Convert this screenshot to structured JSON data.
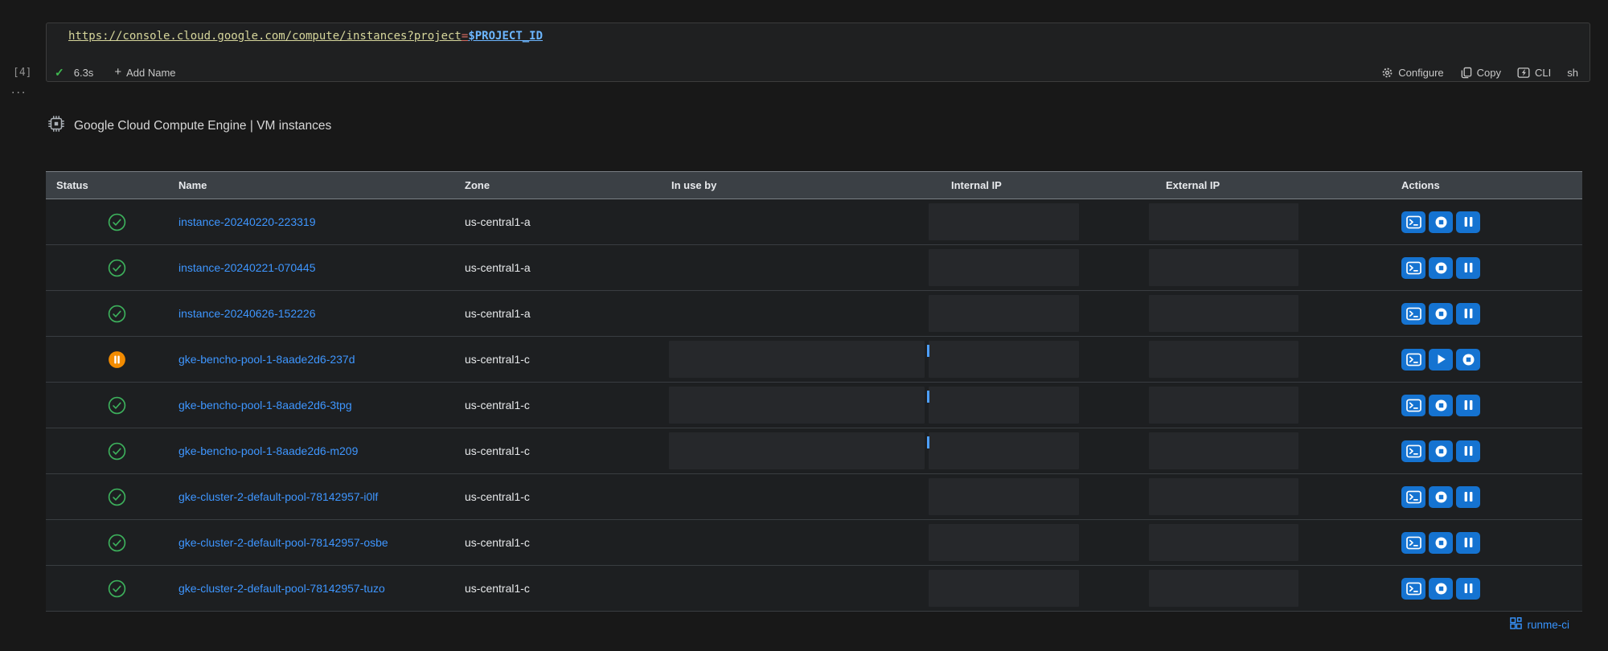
{
  "cell": {
    "execution_label": "[4]",
    "collapsed_indicator": "...",
    "code": {
      "url_base": "https://console.cloud.google.com/compute/instances?project",
      "equals": "=",
      "url_var": "$PROJECT_ID"
    },
    "status": {
      "check_icon": "✓",
      "duration": "6.3s",
      "add_name_label": "Add Name",
      "plus_icon": "+"
    },
    "toolbar": {
      "configure_label": "Configure",
      "copy_label": "Copy",
      "cli_label": "CLI",
      "shell_label": "sh"
    }
  },
  "output": {
    "title": "Google Cloud Compute Engine | VM instances",
    "footer_label": "runme-ci",
    "table": {
      "columns": {
        "status": "Status",
        "name": "Name",
        "zone": "Zone",
        "in_use_by": "In use by",
        "internal_ip": "Internal IP",
        "external_ip": "External IP",
        "actions": "Actions"
      },
      "rows": [
        {
          "status": "running",
          "name": "instance-20240220-223319",
          "zone": "us-central1-a",
          "actions": [
            "ssh",
            "stop",
            "suspend"
          ],
          "redacted": [
            "internal_ip",
            "external_ip"
          ]
        },
        {
          "status": "running",
          "name": "instance-20240221-070445",
          "zone": "us-central1-a",
          "actions": [
            "ssh",
            "stop",
            "suspend"
          ],
          "redacted": [
            "internal_ip",
            "external_ip"
          ]
        },
        {
          "status": "running",
          "name": "instance-20240626-152226",
          "zone": "us-central1-a",
          "actions": [
            "ssh",
            "stop",
            "suspend"
          ],
          "redacted": [
            "internal_ip",
            "external_ip"
          ]
        },
        {
          "status": "suspended",
          "name": "gke-bencho-pool-1-8aade2d6-237d",
          "zone": "us-central1-c",
          "actions": [
            "ssh",
            "start",
            "stop"
          ],
          "redacted": [
            "in_use_by",
            "internal_ip",
            "external_ip"
          ]
        },
        {
          "status": "running",
          "name": "gke-bencho-pool-1-8aade2d6-3tpg",
          "zone": "us-central1-c",
          "actions": [
            "ssh",
            "stop",
            "suspend"
          ],
          "redacted": [
            "in_use_by",
            "internal_ip",
            "external_ip"
          ]
        },
        {
          "status": "running",
          "name": "gke-bencho-pool-1-8aade2d6-m209",
          "zone": "us-central1-c",
          "actions": [
            "ssh",
            "stop",
            "suspend"
          ],
          "redacted": [
            "in_use_by",
            "internal_ip",
            "external_ip"
          ]
        },
        {
          "status": "running",
          "name": "gke-cluster-2-default-pool-78142957-i0lf",
          "zone": "us-central1-c",
          "actions": [
            "ssh",
            "stop",
            "suspend"
          ],
          "redacted": [
            "internal_ip",
            "external_ip"
          ]
        },
        {
          "status": "running",
          "name": "gke-cluster-2-default-pool-78142957-osbe",
          "zone": "us-central1-c",
          "actions": [
            "ssh",
            "stop",
            "suspend"
          ],
          "redacted": [
            "internal_ip",
            "external_ip"
          ]
        },
        {
          "status": "running",
          "name": "gke-cluster-2-default-pool-78142957-tuzo",
          "zone": "us-central1-c",
          "actions": [
            "ssh",
            "stop",
            "suspend"
          ],
          "redacted": [
            "internal_ip",
            "external_ip"
          ]
        }
      ]
    }
  },
  "icons": {
    "cell_success": "check",
    "add_name": "plus",
    "configure": "gear",
    "copy": "copy-pages",
    "cli": "terminal-bolt",
    "output_header": "chip",
    "status_running": "check-circle-green",
    "status_suspended": "pause-circle-orange",
    "action_ssh": "terminal",
    "action_stop": "stop-circle",
    "action_suspend": "pause-bars",
    "action_start": "play-triangle",
    "footer": "extensions-blocks"
  },
  "colors": {
    "url_text": "#d6d69b",
    "url_operator": "#d1695f",
    "url_variable": "#6cb6ff",
    "success_green": "#3fb950",
    "status_running_green": "#3db15c",
    "status_suspended_orange": "#f28b00",
    "link_blue": "#3e96ff",
    "action_button_blue": "#1573d1",
    "footer_blue": "#3794ff",
    "table_header_bg": "#3b4045"
  }
}
